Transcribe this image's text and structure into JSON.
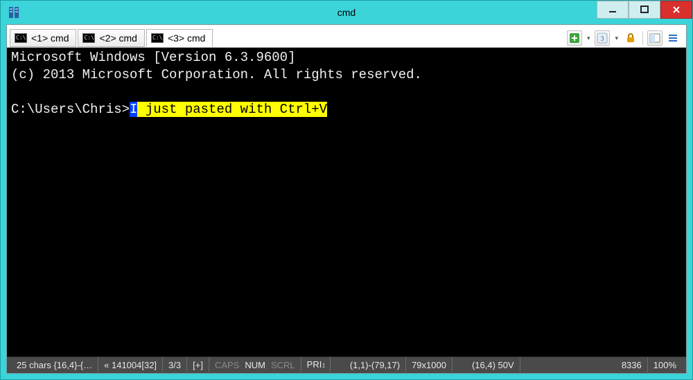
{
  "window": {
    "title": "cmd"
  },
  "tabs": [
    {
      "label": "<1> cmd",
      "active": false
    },
    {
      "label": "<2> cmd",
      "active": false
    },
    {
      "label": "<3> cmd",
      "active": true
    }
  ],
  "terminal": {
    "line1": "Microsoft Windows [Version 6.3.9600]",
    "line2": "(c) 2013 Microsoft Corporation. All rights reserved.",
    "blank": "",
    "prompt": "C:\\Users\\Chris>",
    "pasted_first_char": "I",
    "pasted_rest": " just pasted with Ctrl+V"
  },
  "toolbar": {
    "new_tab": "new-tab",
    "windows": "windows",
    "lock": "lock",
    "split": "split-view",
    "menu": "menu"
  },
  "statusbar": {
    "chars": "25 chars {16,4}-{…",
    "buf": "« 141004[32]",
    "tab_index": "3/3",
    "plus": "[+]",
    "caps": "CAPS",
    "num": "NUM",
    "scrl": "SCRL",
    "pri": "PRI",
    "range": "(1,1)-(79,17)",
    "dims": "79x1000",
    "cursor": "(16,4) 50V",
    "pid": "8336",
    "zoom": "100%"
  },
  "colors": {
    "frame": "#3ad4d9",
    "close": "#d9302e",
    "highlight": "#ffff00"
  }
}
